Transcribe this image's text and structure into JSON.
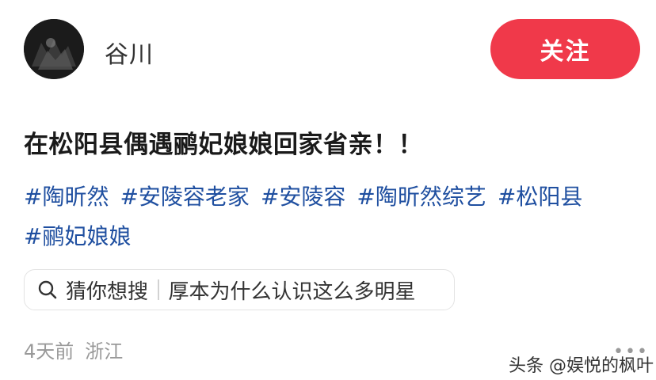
{
  "author": {
    "name": "谷川",
    "follow_label": "关注"
  },
  "post": {
    "title": "在松阳县偶遇鹂妃娘娘回家省亲！！",
    "tags": [
      "#陶昕然",
      "#安陵容老家",
      "#安陵容",
      "#陶昕然综艺",
      "#松阳县",
      "#鹂妃娘娘"
    ]
  },
  "search_suggestion": {
    "prefix": "猜你想搜",
    "query": "厚本为什么认识这么多明星"
  },
  "meta": {
    "time": "4天前",
    "location": "浙江",
    "more_icon": "more-dots-icon"
  },
  "watermark": "头条 @娱悦的枫叶",
  "colors": {
    "accent": "#f0394a",
    "tag": "#1f4fa0",
    "meta": "#999999"
  }
}
